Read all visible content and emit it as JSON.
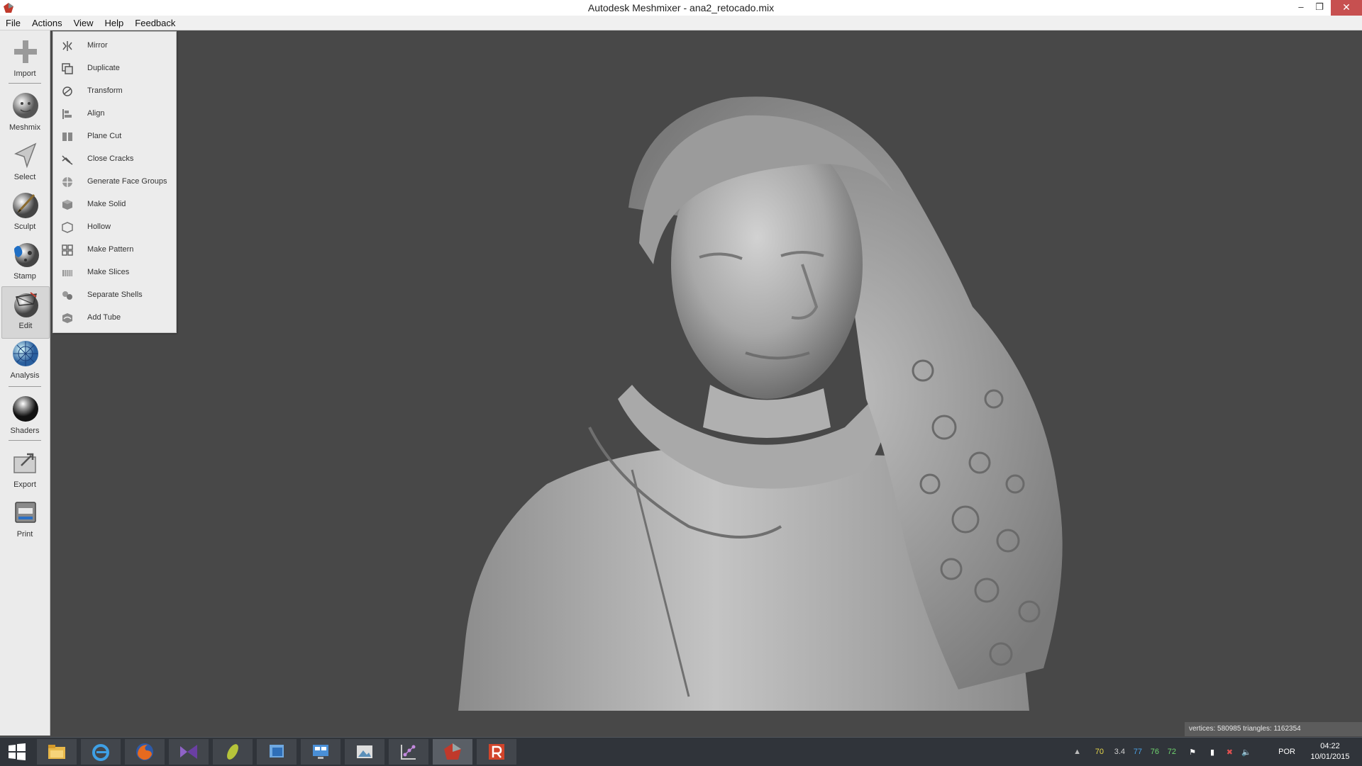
{
  "window": {
    "title": "Autodesk Meshmixer - ana2_retocado.mix",
    "minimize": "–",
    "restore": "❐",
    "close": "✕"
  },
  "menubar": {
    "items": [
      "File",
      "Actions",
      "View",
      "Help",
      "Feedback"
    ]
  },
  "toolbar": {
    "tools": [
      {
        "label": "Import",
        "icon": "plus-icon"
      },
      {
        "label": "Meshmix",
        "icon": "bunny-head-icon"
      },
      {
        "label": "Select",
        "icon": "arrow-cursor-icon"
      },
      {
        "label": "Sculpt",
        "icon": "brush-sphere-icon"
      },
      {
        "label": "Stamp",
        "icon": "stamp-sphere-icon"
      },
      {
        "label": "Edit",
        "icon": "edit-sphere-icon",
        "active": true
      },
      {
        "label": "Analysis",
        "icon": "analysis-sphere-icon"
      },
      {
        "label": "Shaders",
        "icon": "shader-sphere-icon"
      },
      {
        "label": "Export",
        "icon": "export-folder-icon"
      },
      {
        "label": "Print",
        "icon": "printer-icon"
      }
    ]
  },
  "edit_menu": {
    "items": [
      {
        "label": "Mirror",
        "icon": "mirror-icon"
      },
      {
        "label": "Duplicate",
        "icon": "duplicate-icon"
      },
      {
        "label": "Transform",
        "icon": "transform-icon"
      },
      {
        "label": "Align",
        "icon": "align-icon"
      },
      {
        "label": "Plane Cut",
        "icon": "plane-cut-icon"
      },
      {
        "label": "Close Cracks",
        "icon": "close-cracks-icon"
      },
      {
        "label": "Generate Face Groups",
        "icon": "face-groups-icon"
      },
      {
        "label": "Make Solid",
        "icon": "make-solid-icon"
      },
      {
        "label": "Hollow",
        "icon": "hollow-icon"
      },
      {
        "label": "Make Pattern",
        "icon": "make-pattern-icon"
      },
      {
        "label": "Make Slices",
        "icon": "make-slices-icon"
      },
      {
        "label": "Separate Shells",
        "icon": "separate-shells-icon"
      },
      {
        "label": "Add Tube",
        "icon": "add-tube-icon"
      }
    ]
  },
  "viewport": {
    "status": "vertices: 580985 triangles: 1162354"
  },
  "taskbar": {
    "apps": [
      "start-icon",
      "file-explorer-icon",
      "internet-explorer-icon",
      "firefox-icon",
      "visual-studio-icon",
      "meshlab-icon",
      "notes-icon",
      "remote-desktop-icon",
      "image-viewer-icon",
      "graph-tool-icon",
      "meshmixer-icon",
      "revit-icon"
    ],
    "tray_numbers": [
      "70",
      "3.4",
      "77",
      "76",
      "72"
    ],
    "language": "POR",
    "time": "04:22",
    "date": "10/01/2015"
  },
  "colors": {
    "viewport_bg": "#484848",
    "taskbar_bg": "#30343a",
    "close_button": "#c75050",
    "mesh": "#b5b5b5"
  }
}
